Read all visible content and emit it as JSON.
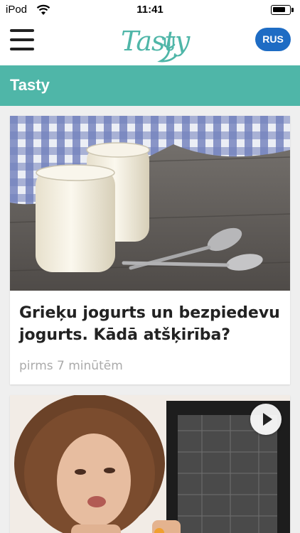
{
  "status_bar": {
    "carrier": "iPod",
    "time": "11:41"
  },
  "header": {
    "logo_text": "Tasty",
    "lang_button": "RUS"
  },
  "section": {
    "title": "Tasty"
  },
  "articles": [
    {
      "title": "Grieķu jogurts un bezpiedevu jogurts. Kādā atšķirība?",
      "time_ago": "pirms 7 minūtēm",
      "has_video": false
    },
    {
      "title": "",
      "time_ago": "",
      "has_video": true
    }
  ],
  "colors": {
    "accent": "#4fb6a8",
    "lang_button": "#1e6cc4",
    "text": "#222222",
    "muted": "#aaaaaa"
  }
}
